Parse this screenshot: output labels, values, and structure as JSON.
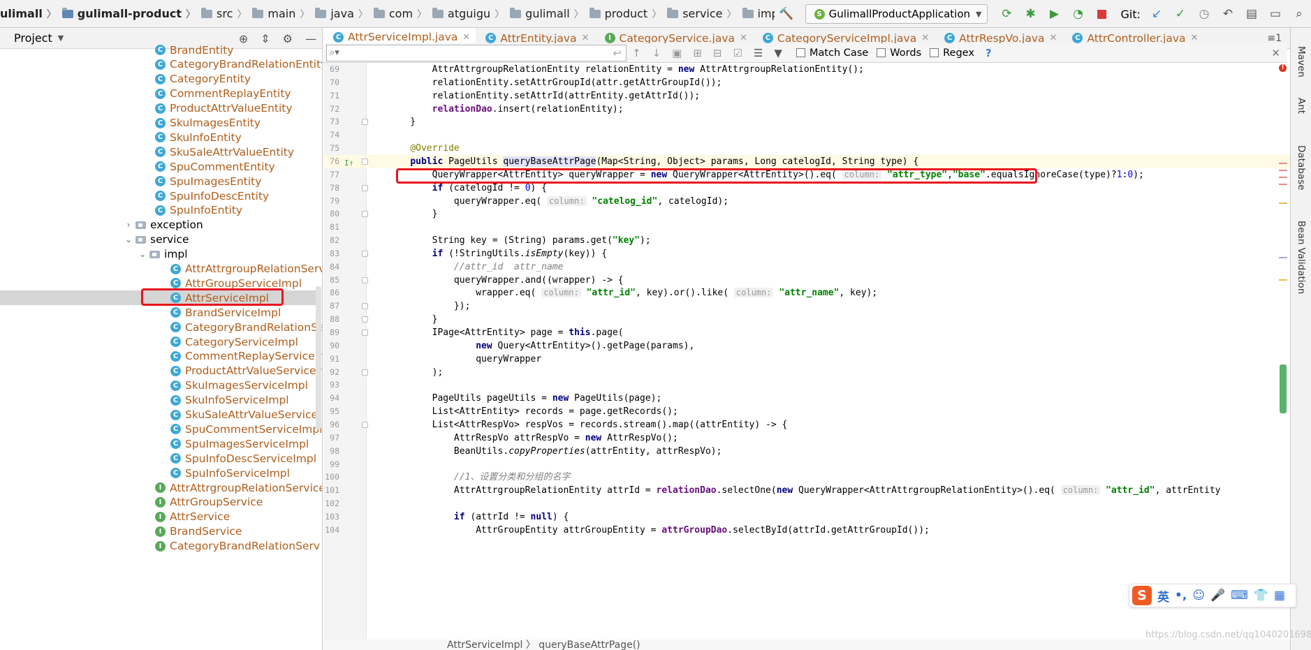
{
  "breadcrumbs": [
    {
      "text": "ulimall",
      "icon": "none",
      "bold": true
    },
    {
      "text": "gulimall-product",
      "icon": "module",
      "bold": true
    },
    {
      "text": "src",
      "icon": "folder"
    },
    {
      "text": "main",
      "icon": "folder"
    },
    {
      "text": "java",
      "icon": "folder"
    },
    {
      "text": "com",
      "icon": "folder"
    },
    {
      "text": "atguigu",
      "icon": "folder"
    },
    {
      "text": "gulimall",
      "icon": "folder"
    },
    {
      "text": "product",
      "icon": "folder"
    },
    {
      "text": "service",
      "icon": "folder"
    },
    {
      "text": "impl",
      "icon": "folder"
    },
    {
      "text": "AttrServiceImpl",
      "icon": "class",
      "red": true
    }
  ],
  "toolbar": {
    "run_config": "GulimallProductApplication",
    "git_label": "Git:"
  },
  "project": {
    "title": "Project",
    "tree": [
      {
        "label": "BrandEntity",
        "kind": "class",
        "indent": 0
      },
      {
        "label": "CategoryBrandRelationEntity",
        "kind": "class",
        "indent": 0
      },
      {
        "label": "CategoryEntity",
        "kind": "class",
        "indent": 0
      },
      {
        "label": "CommentReplayEntity",
        "kind": "class",
        "indent": 0
      },
      {
        "label": "ProductAttrValueEntity",
        "kind": "class",
        "indent": 0
      },
      {
        "label": "SkuImagesEntity",
        "kind": "class",
        "indent": 0
      },
      {
        "label": "SkuInfoEntity",
        "kind": "class",
        "indent": 0
      },
      {
        "label": "SkuSaleAttrValueEntity",
        "kind": "class",
        "indent": 0
      },
      {
        "label": "SpuCommentEntity",
        "kind": "class",
        "indent": 0
      },
      {
        "label": "SpuImagesEntity",
        "kind": "class",
        "indent": 0
      },
      {
        "label": "SpuInfoDescEntity",
        "kind": "class",
        "indent": 0
      },
      {
        "label": "SpuInfoEntity",
        "kind": "class",
        "indent": 0
      },
      {
        "label": "exception",
        "kind": "package",
        "indent": 0,
        "arrow": "right"
      },
      {
        "label": "service",
        "kind": "package",
        "indent": 0,
        "arrow": "down"
      },
      {
        "label": "impl",
        "kind": "package",
        "indent": 1,
        "arrow": "down"
      },
      {
        "label": "AttrAttrgroupRelationServiceImpl",
        "kind": "class",
        "indent": 1
      },
      {
        "label": "AttrGroupServiceImpl",
        "kind": "class",
        "indent": 1
      },
      {
        "label": "AttrServiceImpl",
        "kind": "class",
        "indent": 1,
        "selected": true
      },
      {
        "label": "BrandServiceImpl",
        "kind": "class",
        "indent": 1
      },
      {
        "label": "CategoryBrandRelationServiceImpl",
        "kind": "class",
        "indent": 1
      },
      {
        "label": "CategoryServiceImpl",
        "kind": "class",
        "indent": 1
      },
      {
        "label": "CommentReplayServiceImpl",
        "kind": "class",
        "indent": 1
      },
      {
        "label": "ProductAttrValueServiceImpl",
        "kind": "class",
        "indent": 1
      },
      {
        "label": "SkuImagesServiceImpl",
        "kind": "class",
        "indent": 1
      },
      {
        "label": "SkuInfoServiceImpl",
        "kind": "class",
        "indent": 1
      },
      {
        "label": "SkuSaleAttrValueServiceImpl",
        "kind": "class",
        "indent": 1
      },
      {
        "label": "SpuCommentServiceImpl",
        "kind": "class",
        "indent": 1
      },
      {
        "label": "SpuImagesServiceImpl",
        "kind": "class",
        "indent": 1
      },
      {
        "label": "SpuInfoDescServiceImpl",
        "kind": "class",
        "indent": 1
      },
      {
        "label": "SpuInfoServiceImpl",
        "kind": "class",
        "indent": 1
      },
      {
        "label": "AttrAttrgroupRelationService",
        "kind": "interface",
        "indent": 0
      },
      {
        "label": "AttrGroupService",
        "kind": "interface",
        "indent": 0
      },
      {
        "label": "AttrService",
        "kind": "interface",
        "indent": 0
      },
      {
        "label": "BrandService",
        "kind": "interface",
        "indent": 0
      },
      {
        "label": "CategoryBrandRelationServ",
        "kind": "interface",
        "indent": 0
      }
    ]
  },
  "tabs": [
    {
      "label": "AttrServiceImpl.java",
      "icon": "C",
      "active": true
    },
    {
      "label": "AttrEntity.java",
      "icon": "C"
    },
    {
      "label": "CategoryService.java",
      "icon": "I"
    },
    {
      "label": "CategoryServiceImpl.java",
      "icon": "C"
    },
    {
      "label": "AttrRespVo.java",
      "icon": "C"
    },
    {
      "label": "AttrController.java",
      "icon": "C"
    }
  ],
  "tabs_overflow": "≡1",
  "find": {
    "placeholder": "",
    "match_case": "Match Case",
    "words": "Words",
    "regex": "Regex",
    "help": "?"
  },
  "code": [
    {
      "ln": "69",
      "html": "        AttrAttrgroupRelationEntity relationEntity = <span class='kw'>new</span> AttrAttrgroupRelationEntity();"
    },
    {
      "ln": "70",
      "html": "        relationEntity.setAttrGroupId(attr.getAttrGroupId());"
    },
    {
      "ln": "71",
      "html": "        relationEntity.setAttrId(attrEntity.getAttrId());"
    },
    {
      "ln": "72",
      "html": "        <span class='fld'>relationDao</span>.insert(relationEntity);"
    },
    {
      "ln": "73",
      "html": "    }"
    },
    {
      "ln": "74",
      "html": ""
    },
    {
      "ln": "75",
      "html": "    <span class='ann'>@Override</span>"
    },
    {
      "ln": "76",
      "html": "    <span class='kw'>public</span> PageUtils <span class='mth-hl'>queryBaseAttrPage</span>(Map&lt;String, Object&gt; params, Long catelogId, String type) {"
    },
    {
      "ln": "77",
      "html": "        QueryWrapper&lt;AttrEntity&gt; queryWrapper = <span class='kw'>new</span> QueryWrapper&lt;AttrEntity&gt;().eq( <span class='hint'>column:</span> <span class='str'>\"attr_type\"</span>,<span class='str'>\"base\"</span>.equalsIgnoreCase(type)?<span class='num'>1</span>:<span class='num'>0</span>);"
    },
    {
      "ln": "78",
      "html": "        <span class='kw'>if</span> (catelogId != <span class='num'>0</span>) {"
    },
    {
      "ln": "79",
      "html": "            queryWrapper.eq( <span class='hint'>column:</span> <span class='str'>\"catelog_id\"</span>, catelogId);"
    },
    {
      "ln": "80",
      "html": "        }"
    },
    {
      "ln": "81",
      "html": ""
    },
    {
      "ln": "82",
      "html": "        String key = (String) params.get(<span class='str'>\"key\"</span>);"
    },
    {
      "ln": "83",
      "html": "        <span class='kw'>if</span> (!StringUtils.<span class='stat'>isEmpty</span>(key)) {"
    },
    {
      "ln": "84",
      "html": "            <span class='cm'>//attr_id  attr_name</span>"
    },
    {
      "ln": "85",
      "html": "            queryWrapper.and((wrapper) -&gt; {"
    },
    {
      "ln": "86",
      "html": "                wrapper.eq( <span class='hint'>column:</span> <span class='str'>\"attr_id\"</span>, key).or().like( <span class='hint'>column:</span> <span class='str'>\"attr_name\"</span>, key);"
    },
    {
      "ln": "87",
      "html": "            });"
    },
    {
      "ln": "88",
      "html": "        }"
    },
    {
      "ln": "89",
      "html": "        IPage&lt;AttrEntity&gt; page = <span class='kw'>this</span>.page("
    },
    {
      "ln": "90",
      "html": "                <span class='kw'>new</span> Query&lt;AttrEntity&gt;().getPage(params),"
    },
    {
      "ln": "91",
      "html": "                queryWrapper"
    },
    {
      "ln": "92",
      "html": "        );"
    },
    {
      "ln": "93",
      "html": ""
    },
    {
      "ln": "94",
      "html": "        PageUtils pageUtils = <span class='kw'>new</span> PageUtils(page);"
    },
    {
      "ln": "95",
      "html": "        List&lt;AttrEntity&gt; records = page.getRecords();"
    },
    {
      "ln": "96",
      "html": "        List&lt;AttrRespVo&gt; respVos = records.stream().map((attrEntity) -&gt; {"
    },
    {
      "ln": "97",
      "html": "            AttrRespVo attrRespVo = <span class='kw'>new</span> AttrRespVo();"
    },
    {
      "ln": "98",
      "html": "            BeanUtils.<span class='stat'>copyProperties</span>(attrEntity, attrRespVo);"
    },
    {
      "ln": "99",
      "html": ""
    },
    {
      "ln": "100",
      "html": "            <span class='cm'>//1、设置分类和分组的名字</span>"
    },
    {
      "ln": "101",
      "html": "            AttrAttrgroupRelationEntity attrId = <span class='fld'>relationDao</span>.selectOne(<span class='kw'>new</span> QueryWrapper&lt;AttrAttrgroupRelationEntity&gt;().eq( <span class='hint'>column:</span> <span class='str'>\"attr_id\"</span>, attrEntity"
    },
    {
      "ln": "102",
      "html": ""
    },
    {
      "ln": "103",
      "html": "            <span class='kw'>if</span> (attrId != <span class='kw'>null</span>) {"
    },
    {
      "ln": "104",
      "html": "                AttrGroupEntity attrGroupEntity = <span class='fld'>attrGroupDao</span>.selectById(attrId.getAttrGroupId());"
    }
  ],
  "editor_breadcrumb": "AttrServiceImpl  〉 queryBaseAttrPage()",
  "side_panels": [
    "Maven",
    "Ant",
    "Database",
    "Bean Validation"
  ],
  "ime": {
    "logo": "S",
    "lang": "英"
  },
  "watermark": "https://blog.csdn.net/qq1040201698"
}
